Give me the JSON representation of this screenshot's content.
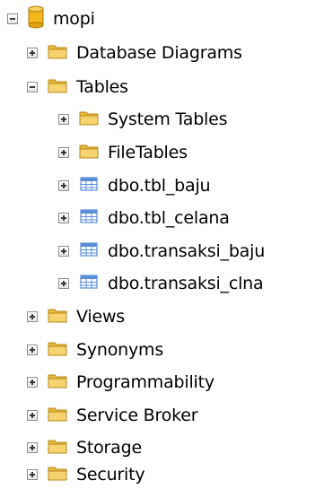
{
  "tree": {
    "database": {
      "label": "mopi",
      "icon": "database-icon",
      "expanded": true
    },
    "folders": [
      {
        "label": "Database Diagrams",
        "icon": "folder-icon",
        "expanded": false
      },
      {
        "label": "Tables",
        "icon": "folder-icon",
        "expanded": true
      },
      {
        "label": "Views",
        "icon": "folder-icon",
        "expanded": false
      },
      {
        "label": "Synonyms",
        "icon": "folder-icon",
        "expanded": false
      },
      {
        "label": "Programmability",
        "icon": "folder-icon",
        "expanded": false
      },
      {
        "label": "Service Broker",
        "icon": "folder-icon",
        "expanded": false
      },
      {
        "label": "Storage",
        "icon": "folder-icon",
        "expanded": false
      },
      {
        "label": "Security",
        "icon": "folder-icon",
        "expanded": false
      }
    ],
    "tables_children": [
      {
        "label": "System Tables",
        "icon": "folder-icon",
        "expanded": false
      },
      {
        "label": "FileTables",
        "icon": "folder-icon",
        "expanded": false
      },
      {
        "label": "dbo.tbl_baju",
        "icon": "table-icon",
        "expanded": false
      },
      {
        "label": "dbo.tbl_celana",
        "icon": "table-icon",
        "expanded": false
      },
      {
        "label": "dbo.transaksi_baju",
        "icon": "table-icon",
        "expanded": false
      },
      {
        "label": "dbo.transaksi_clna",
        "icon": "table-icon",
        "expanded": false
      }
    ]
  },
  "colors": {
    "folder": "#e9b93c",
    "folder_light": "#f6d36f",
    "database": "#f2b81b",
    "table_blue": "#5a8fd6"
  }
}
